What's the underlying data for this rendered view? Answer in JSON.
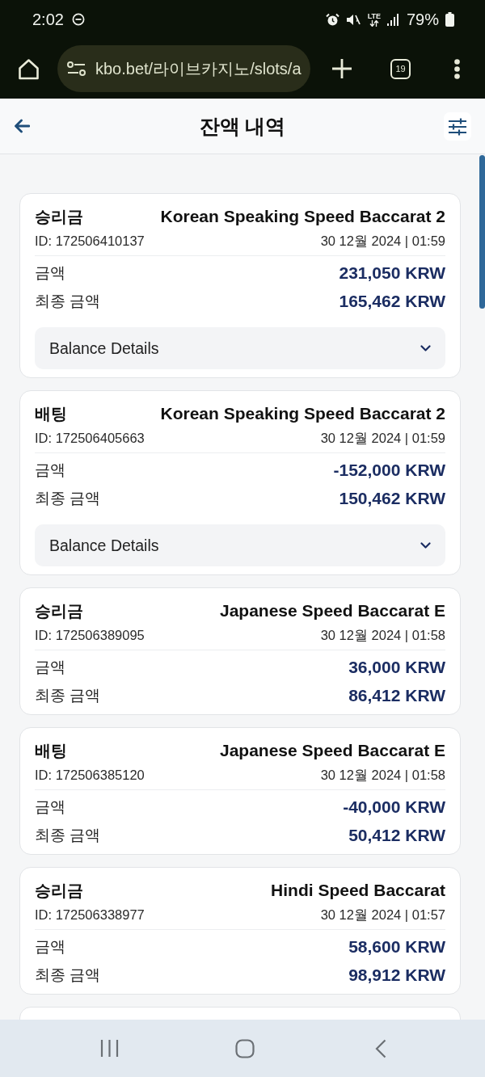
{
  "status_bar": {
    "time": "2:02",
    "network": "LTE",
    "battery": "79%"
  },
  "browser": {
    "url": "kbo.bet/라이브카지노/slots/a",
    "tab_count": "19"
  },
  "header": {
    "title": "잔액 내역"
  },
  "transactions": [
    {
      "type": "승리금",
      "game": "Korean Speaking Speed Baccarat 2",
      "id": "ID: 172506410137",
      "date": "30 12월 2024 | 01:59",
      "rows": [
        {
          "label": "금액",
          "value": "231,050 KRW"
        },
        {
          "label": "최종 금액",
          "value": "165,462 KRW"
        }
      ],
      "details": {
        "label": "Balance Details",
        "expanded": false
      }
    },
    {
      "type": "배팅",
      "game": "Korean Speaking Speed Baccarat 2",
      "id": "ID: 172506405663",
      "date": "30 12월 2024 | 01:59",
      "rows": [
        {
          "label": "금액",
          "value": "-152,000 KRW"
        },
        {
          "label": "최종 금액",
          "value": "150,462 KRW"
        }
      ],
      "details": {
        "label": "Balance Details",
        "expanded": false
      }
    },
    {
      "type": "승리금",
      "game": "Japanese Speed Baccarat E",
      "id": "ID: 172506389095",
      "date": "30 12월 2024 | 01:58",
      "rows": [
        {
          "label": "금액",
          "value": "36,000 KRW"
        },
        {
          "label": "최종 금액",
          "value": "86,412 KRW"
        }
      ]
    },
    {
      "type": "배팅",
      "game": "Japanese Speed Baccarat E",
      "id": "ID: 172506385120",
      "date": "30 12월 2024 | 01:58",
      "rows": [
        {
          "label": "금액",
          "value": "-40,000 KRW"
        },
        {
          "label": "최종 금액",
          "value": "50,412 KRW"
        }
      ]
    },
    {
      "type": "승리금",
      "game": "Hindi Speed Baccarat",
      "id": "ID: 172506338977",
      "date": "30 12월 2024 | 01:57",
      "rows": [
        {
          "label": "금액",
          "value": "58,600 KRW"
        },
        {
          "label": "최종 금액",
          "value": "98,912 KRW"
        }
      ]
    }
  ],
  "more_below": true
}
